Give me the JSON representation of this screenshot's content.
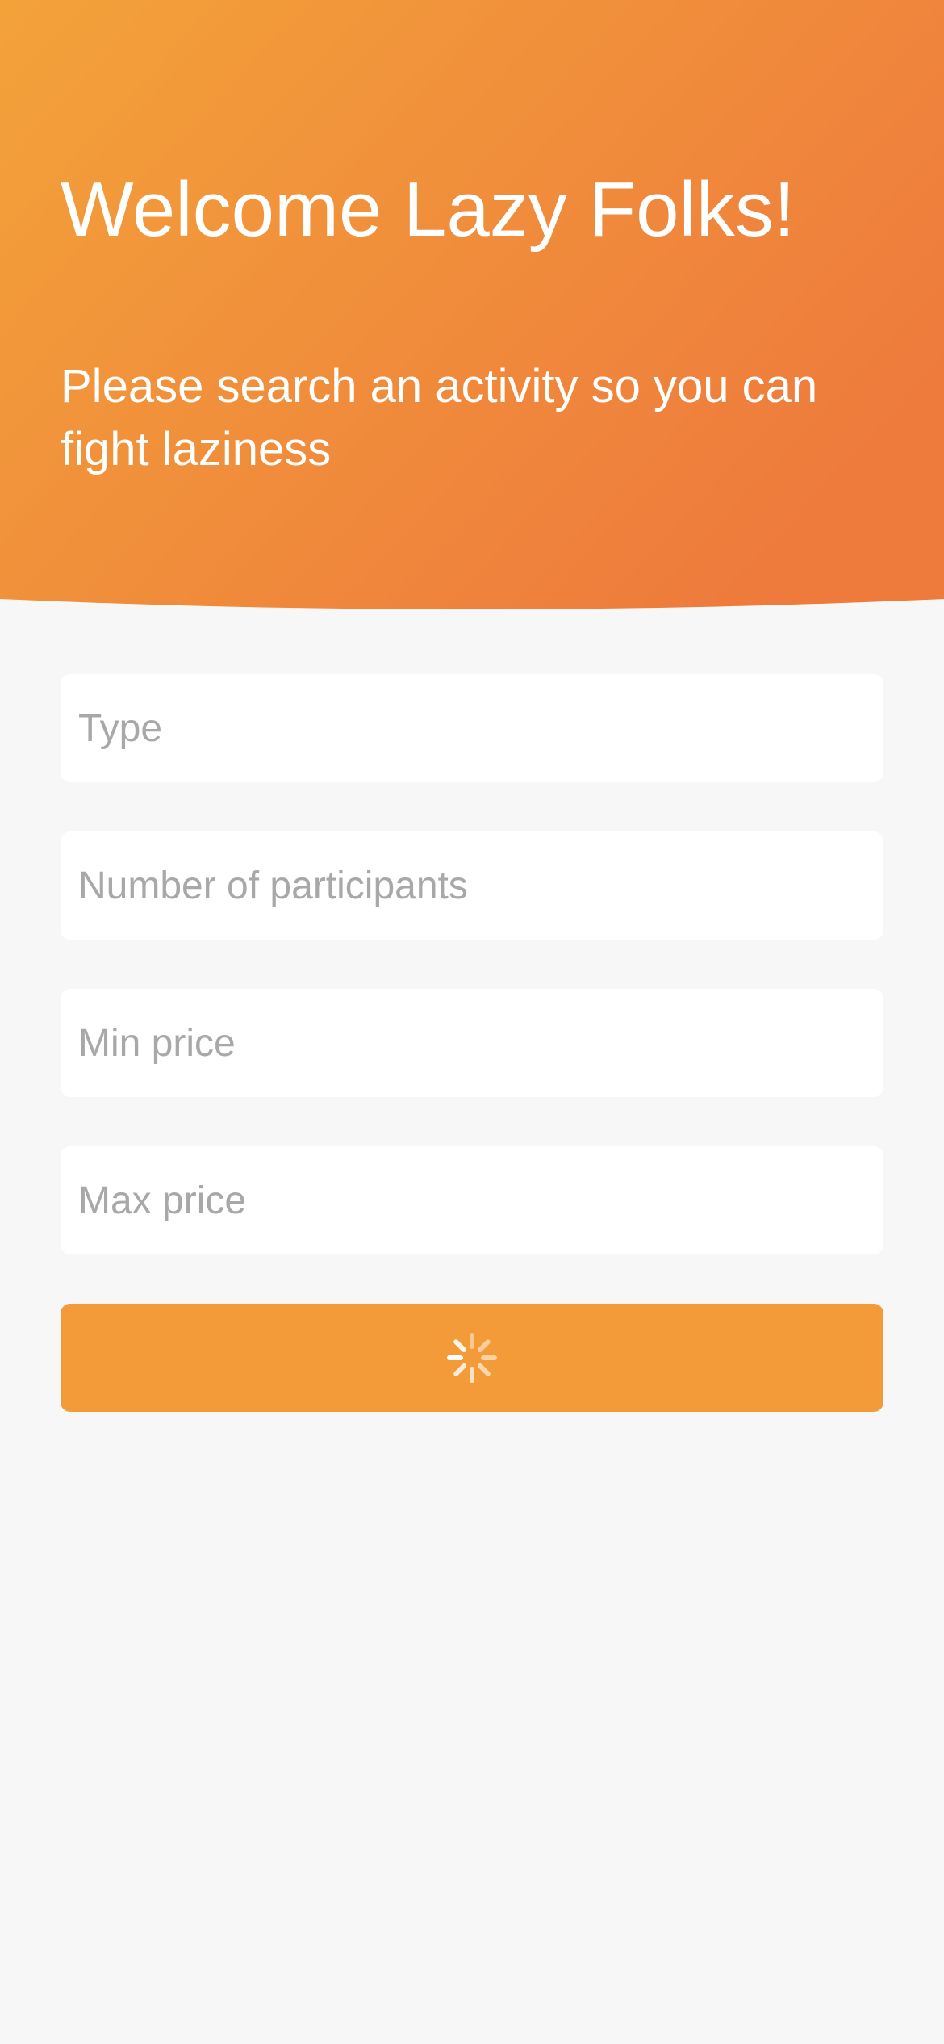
{
  "header": {
    "title": "Welcome Lazy Folks!",
    "subtitle": "Please search an activity so you can fight laziness"
  },
  "form": {
    "type_placeholder": "Type",
    "participants_placeholder": "Number of participants",
    "min_price_placeholder": "Min price",
    "max_price_placeholder": "Max price",
    "search_button_state": "loading",
    "search_button_icon": "spinner-icon"
  },
  "colors": {
    "gradient_start": "#f3a23a",
    "gradient_end": "#ee7b3c",
    "button": "#f29b38",
    "background": "#f7f7f7",
    "placeholder": "#a8a8a8"
  }
}
